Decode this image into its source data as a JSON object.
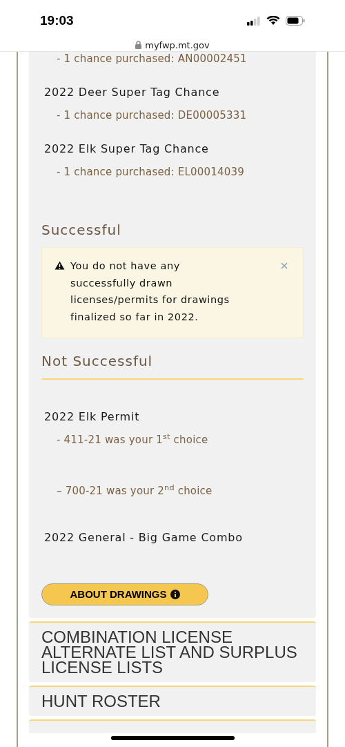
{
  "status_bar": {
    "time": "19:03"
  },
  "address_bar": {
    "url": "myfwp.mt.gov"
  },
  "purchases": [
    {
      "details": [
        "- 1 chance purchased: AN00002451"
      ]
    },
    {
      "title": "2022 Deer Super Tag Chance",
      "details": [
        "- 1 chance purchased: DE00005331"
      ]
    },
    {
      "title": "2022 Elk Super Tag Chance",
      "details": [
        "- 1 chance purchased: EL00014039"
      ]
    }
  ],
  "successful": {
    "heading": "Successful",
    "alert": {
      "text": "You do not have any successfully drawn licenses/permits for drawings finalized so far in 2022.",
      "dismissible": true
    }
  },
  "not_successful": {
    "heading": "Not Successful",
    "items": [
      {
        "title": "2022 Elk Permit",
        "choices": [
          "- 411-21 was your 1$^{st}$ choice",
          "– 700-21 was your 2$^{nd}$ choice"
        ]
      },
      {
        "title": "2022 General - Big Game Combo"
      }
    ]
  },
  "about_button": "ABOUT DRAWINGS",
  "sections": [
    "COMBINATION LICENSE ALTERNATE LIST AND SURPLUS LICENSE LISTS",
    "HUNT ROSTER"
  ]
}
